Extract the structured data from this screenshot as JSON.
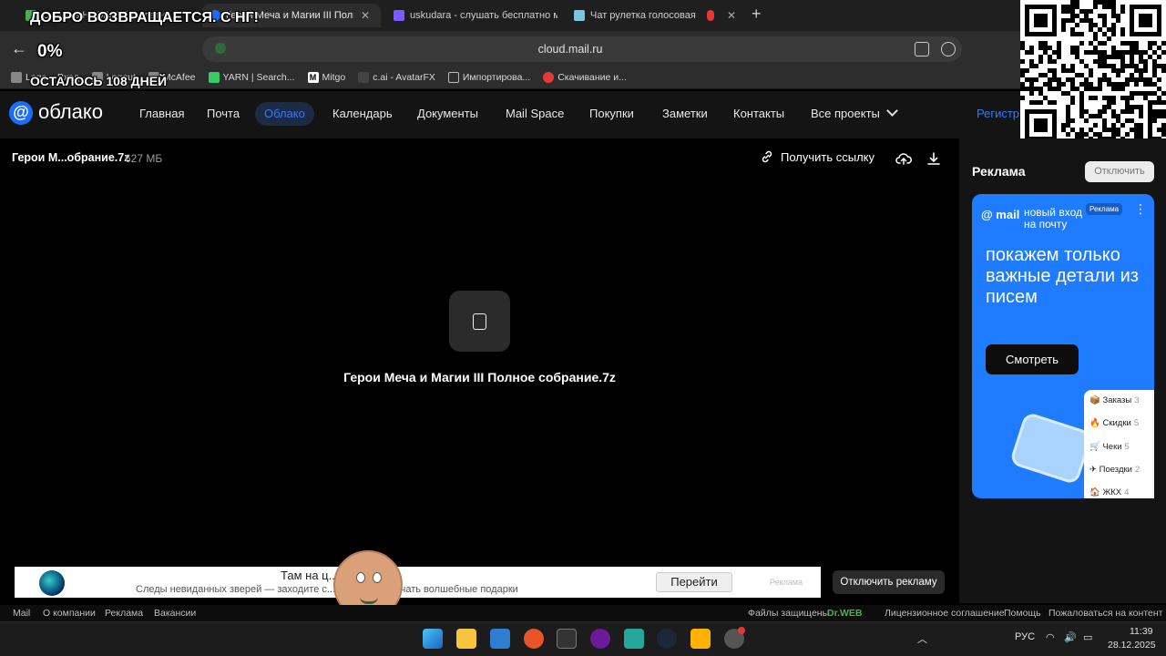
{
  "browser": {
    "tabs": [
      {
        "label": "Скачать HOMM3 бесплатно",
        "active": false
      },
      {
        "label": "Герои Меча и Магии III Полн",
        "active": true
      },
      {
        "label": "uskudara - слушать бесплатно му",
        "active": false
      },
      {
        "label": "Чат рулетка голосовая",
        "active": false
      }
    ],
    "new_tab": "+",
    "close_symbol": "✕",
    "url": "cloud.mail.ru",
    "back_symbol": "←",
    "bookmarks": [
      {
        "label": "Lego – Вход",
        "color": "#888888"
      },
      {
        "label": "Logout",
        "color": "#888888"
      },
      {
        "label": "McAfee",
        "color": "#888888"
      },
      {
        "label": "YARN | Search...",
        "color": "#33cc66"
      },
      {
        "label": "Mitgo",
        "color": "#222222"
      },
      {
        "label": "c.ai - AvatarFX",
        "color": "#444444"
      },
      {
        "label": "Импортирова...",
        "color": "#777777"
      },
      {
        "label": "Скачивание и...",
        "color": "#e53935"
      }
    ]
  },
  "overlay": {
    "line1": "ДОБРО ВОЗВРАЩАЕТСЯ. С НГ!",
    "line2": "0%",
    "line3": "ОСТАЛОСЬ 108 ДНЕЙ"
  },
  "cloud": {
    "logo_symbol": "@",
    "logo_text": "облако",
    "nav": [
      "Главная",
      "Почта",
      "Облако",
      "Календарь",
      "Документы",
      "Mail Space",
      "Покупки",
      "Заметки",
      "Контакты",
      "Все проекты"
    ],
    "nav_active": "Облако",
    "register": "Регистр",
    "accent": "#2e7bff"
  },
  "file": {
    "short_name": "Герои М...обрание.7z",
    "size": "627 МБ",
    "get_link": "Получить ссылку",
    "title": "Герои Меча и Магии III Полное собрание.7z"
  },
  "ad_panel": {
    "title": "Реклама",
    "disable": "Отключить",
    "card": {
      "brand": "@ mail",
      "new_text": "новый вход\nна почту",
      "badge": "Реклама",
      "headline": "покажем только важные детали из писем",
      "button": "Смотреть",
      "list": [
        {
          "label": "Заказы",
          "count": "3"
        },
        {
          "label": "Скидки",
          "count": "5"
        },
        {
          "label": "Чеки",
          "count": "5"
        },
        {
          "label": "Поездки",
          "count": "2"
        },
        {
          "label": "ЖКХ",
          "count": "4"
        }
      ]
    }
  },
  "banner": {
    "title": "Там на ц... ...ожках",
    "subtitle": "Следы невиданных зверей — заходите с... ...ядки и получать волшебные подарки",
    "go": "Перейти",
    "ad_label": "Реклама",
    "disable_ads": "Отключить рекламу"
  },
  "footer": {
    "left": [
      "Mail",
      "О компании",
      "Реклама",
      "Вакансии"
    ],
    "protected": "Файлы защищены",
    "drweb": "Dr.WEB",
    "right": [
      "Лицензионное соглашение",
      "Помощь",
      "Пожаловаться на контент"
    ]
  },
  "taskbar": {
    "lang": "РУС",
    "time": "11:39",
    "date": "28.12.2025"
  }
}
